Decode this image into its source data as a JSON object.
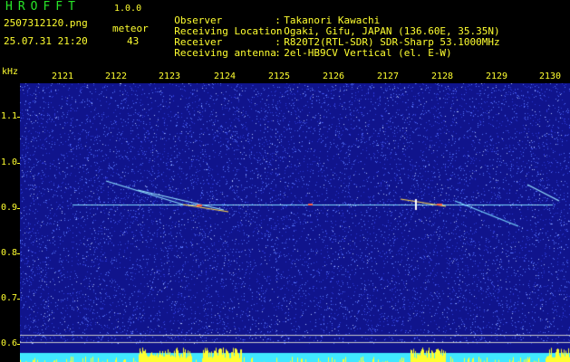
{
  "header": {
    "logo": "HROFFT",
    "version": "1.0.0",
    "filename": "2507312120.png",
    "datetime": "25.07.31 21:20",
    "meteor_label": "meteor",
    "meteor_count": "43"
  },
  "info": [
    {
      "key": "Observer",
      "value": "Takanori Kawachi"
    },
    {
      "key": "Receiving Location",
      "value": "Ogaki, Gifu, JAPAN (136.60E, 35.35N)"
    },
    {
      "key": "Receiver",
      "value": "R820T2(RTL-SDR) SDR-Sharp 53.1000MHz"
    },
    {
      "key": "Receiving antenna",
      "value": "2el-HB9CV Vertical (el. E-W)"
    }
  ],
  "spectrogram": {
    "y_unit": "kHz",
    "y_ticks": [
      "1.1",
      "1.0",
      "0.9",
      "0.8",
      "0.7",
      "0.6"
    ],
    "x_ticks": [
      "2121",
      "2122",
      "2123",
      "2124",
      "2125",
      "2126",
      "2127",
      "2128",
      "2129",
      "2130"
    ],
    "colors": {
      "background": "#10148c",
      "noise": "#5a78ff",
      "signal": "#ffff30",
      "baseline": "#40e8ff",
      "label": "#ffff30"
    }
  }
}
